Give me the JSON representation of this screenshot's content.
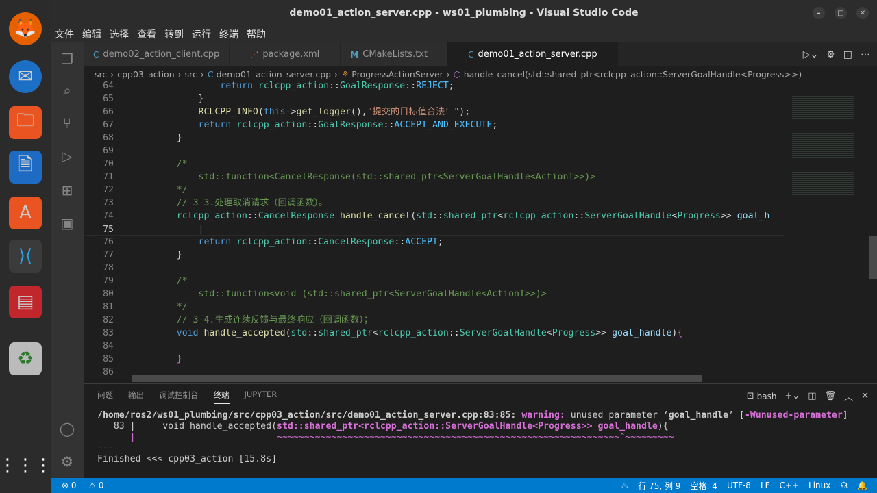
{
  "window": {
    "title": "demo01_action_server.cpp - ws01_plumbing - Visual Studio Code"
  },
  "menu": [
    "文件",
    "编辑",
    "选择",
    "查看",
    "转到",
    "运行",
    "终端",
    "帮助"
  ],
  "tabs": [
    {
      "label": "demo02_action_client.cpp",
      "icon": "C"
    },
    {
      "label": "package.xml",
      "icon": "⋰"
    },
    {
      "label": "CMakeLists.txt",
      "icon": "M"
    },
    {
      "label": "demo01_action_server.cpp",
      "icon": "C"
    }
  ],
  "breadcrumb": [
    "src",
    "cpp03_action",
    "src",
    "demo01_action_server.cpp",
    "ProgressActionServer",
    "handle_cancel(std::shared_ptr<rclcpp_action::ServerGoalHandle<Progress>>)"
  ],
  "code": [
    {
      "n": "64",
      "segs": [
        [
          "p",
          "            "
        ],
        [
          "k",
          "return "
        ],
        [
          "t",
          "rclcpp_action"
        ],
        [
          "p",
          "::"
        ],
        [
          "t",
          "GoalResponse"
        ],
        [
          "p",
          "::"
        ],
        [
          "m",
          "REJECT"
        ],
        [
          "p",
          ";"
        ]
      ]
    },
    {
      "n": "65",
      "segs": [
        [
          "p",
          "        }"
        ]
      ]
    },
    {
      "n": "66",
      "segs": [
        [
          "p",
          "        "
        ],
        [
          "f",
          "RCLCPP_INFO"
        ],
        [
          "p",
          "("
        ],
        [
          "k",
          "this"
        ],
        [
          "p",
          "->"
        ],
        [
          "f",
          "get_logger"
        ],
        [
          "p",
          "(),"
        ],
        [
          "s",
          "\"提交的目标值合法！\""
        ],
        [
          "p",
          ");"
        ]
      ]
    },
    {
      "n": "67",
      "segs": [
        [
          "p",
          "        "
        ],
        [
          "k",
          "return "
        ],
        [
          "t",
          "rclcpp_action"
        ],
        [
          "p",
          "::"
        ],
        [
          "t",
          "GoalResponse"
        ],
        [
          "p",
          "::"
        ],
        [
          "m",
          "ACCEPT_AND_EXECUTE"
        ],
        [
          "p",
          ";"
        ]
      ]
    },
    {
      "n": "68",
      "segs": [
        [
          "p",
          "    }"
        ]
      ]
    },
    {
      "n": "69",
      "segs": []
    },
    {
      "n": "70",
      "segs": [
        [
          "c",
          "    /*"
        ]
      ]
    },
    {
      "n": "71",
      "segs": [
        [
          "c",
          "        std::function<CancelResponse(std::shared_ptr<ServerGoalHandle<ActionT>>)>"
        ]
      ]
    },
    {
      "n": "72",
      "segs": [
        [
          "c",
          "    */"
        ]
      ]
    },
    {
      "n": "73",
      "segs": [
        [
          "c",
          "    // 3-3.处理取消请求（回调函数）。"
        ]
      ]
    },
    {
      "n": "74",
      "segs": [
        [
          "p",
          "    "
        ],
        [
          "t",
          "rclcpp_action"
        ],
        [
          "p",
          "::"
        ],
        [
          "t",
          "CancelResponse "
        ],
        [
          "f",
          "handle_cancel"
        ],
        [
          "p",
          "("
        ],
        [
          "t",
          "std"
        ],
        [
          "p",
          "::"
        ],
        [
          "t",
          "shared_ptr"
        ],
        [
          "p",
          "<"
        ],
        [
          "t",
          "rclcpp_action"
        ],
        [
          "p",
          "::"
        ],
        [
          "t",
          "ServerGoalHandle"
        ],
        [
          "p",
          "<"
        ],
        [
          "t",
          "Progress"
        ],
        [
          "p",
          ">> "
        ],
        [
          "v",
          "goal_h"
        ]
      ]
    },
    {
      "n": "75",
      "segs": [
        [
          "p",
          "        |"
        ]
      ]
    },
    {
      "n": "76",
      "segs": [
        [
          "p",
          "        "
        ],
        [
          "k",
          "return "
        ],
        [
          "t",
          "rclcpp_action"
        ],
        [
          "p",
          "::"
        ],
        [
          "t",
          "CancelResponse"
        ],
        [
          "p",
          "::"
        ],
        [
          "m",
          "ACCEPT"
        ],
        [
          "p",
          ";"
        ]
      ]
    },
    {
      "n": "77",
      "segs": [
        [
          "p",
          "    }"
        ]
      ]
    },
    {
      "n": "78",
      "segs": []
    },
    {
      "n": "79",
      "segs": [
        [
          "c",
          "    /*"
        ]
      ]
    },
    {
      "n": "80",
      "segs": [
        [
          "c",
          "        std::function<void (std::shared_ptr<ServerGoalHandle<ActionT>>)>"
        ]
      ]
    },
    {
      "n": "81",
      "segs": [
        [
          "c",
          "    */"
        ]
      ]
    },
    {
      "n": "82",
      "segs": [
        [
          "c",
          "    // 3-4.生成连续反馈与最终响应（回调函数）；"
        ]
      ]
    },
    {
      "n": "83",
      "segs": [
        [
          "p",
          "    "
        ],
        [
          "k",
          "void "
        ],
        [
          "f",
          "handle_accepted"
        ],
        [
          "p",
          "("
        ],
        [
          "t",
          "std"
        ],
        [
          "p",
          "::"
        ],
        [
          "t",
          "shared_ptr"
        ],
        [
          "p",
          "<"
        ],
        [
          "t",
          "rclcpp_action"
        ],
        [
          "p",
          "::"
        ],
        [
          "t",
          "ServerGoalHandle"
        ],
        [
          "p",
          "<"
        ],
        [
          "t",
          "Progress"
        ],
        [
          "p",
          ">> "
        ],
        [
          "v",
          "goal_handle"
        ],
        [
          "p",
          ")"
        ],
        [
          "b",
          "{"
        ]
      ]
    },
    {
      "n": "84",
      "segs": []
    },
    {
      "n": "85",
      "segs": [
        [
          "p",
          "    "
        ],
        [
          "b",
          "}"
        ]
      ]
    },
    {
      "n": "86",
      "segs": []
    }
  ],
  "panel": {
    "tabs": [
      "问题",
      "输出",
      "调试控制台",
      "终端",
      "JUPYTER"
    ],
    "active": 3,
    "shell": "bash",
    "lines": {
      "path": "/home/ros2/ws01_plumbing/src/cpp03_action/src/demo01_action_server.cpp:83:85:",
      "warning": "warning:",
      "msg": " unused parameter ‘",
      "param": "goal_handle",
      "msg2": "’ [",
      "flag": "-Wunused-parameter",
      "close": "]",
      "l2num": "   83 |     void handle_accepted(",
      "l2hl": "std::shared_ptr<rclcpp_action::ServerGoalHandle<Progress>> goal_handle",
      "l2end": "){",
      "l3": "      |                          ~~~~~~~~~~~~~~~~~~~~~~~~~~~~~~~~~~~~~~~~~~~~~~~~~~~~~~~~~~~~~~~^~~~~~~~~~",
      "l4": "---",
      "l5": "Finished <<< cpp03_action [15.8s]"
    }
  },
  "status": {
    "errors": "0",
    "warnings": "0",
    "position": "行 75, 列 9",
    "spaces": "空格: 4",
    "encoding": "UTF-8",
    "eol": "LF",
    "language": "C++",
    "platform": "Linux"
  },
  "colors": {
    "status": "#007acc",
    "editor": "#1e1e1e"
  }
}
